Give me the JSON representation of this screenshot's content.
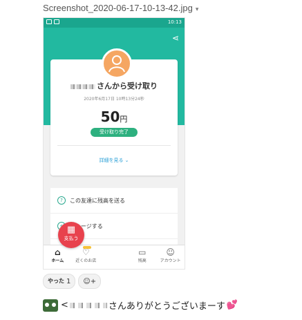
{
  "file": {
    "name": "Screenshot_2020-06-17-10-13-42.jpg",
    "caret": "▾"
  },
  "status": {
    "time": "10:13"
  },
  "receipt": {
    "title_suffix": "さんから受け取り",
    "date": "2020年6月17日 10時13分24秒",
    "amount": "50",
    "currency": "円",
    "status": "受け取り完了",
    "details_link": "詳細を見る ⌄"
  },
  "menu": [
    {
      "icon": "?",
      "label": "この友達に残高を送る"
    },
    {
      "icon": "+",
      "label": "チャージする"
    }
  ],
  "tabs": [
    {
      "icon": "⌂",
      "label": "ホーム"
    },
    {
      "icon": "♡",
      "label": "近くのお店"
    },
    {
      "icon": "▭",
      "label": "残高"
    },
    {
      "icon": "☺",
      "label": "アカウント"
    }
  ],
  "pay_button": {
    "icon": "▦",
    "label": "支払う"
  },
  "reactions": [
    {
      "emoji": "やった",
      "count": "1"
    },
    {
      "emoji": "☺+",
      "count": ""
    }
  ],
  "message": {
    "prefix": "<",
    "text": "さんありがとうございまーす",
    "emoji": "💕"
  },
  "colors": {
    "teal": "#22b9a0",
    "pay_red": "#e8424d",
    "badge_green": "#2db07f"
  }
}
